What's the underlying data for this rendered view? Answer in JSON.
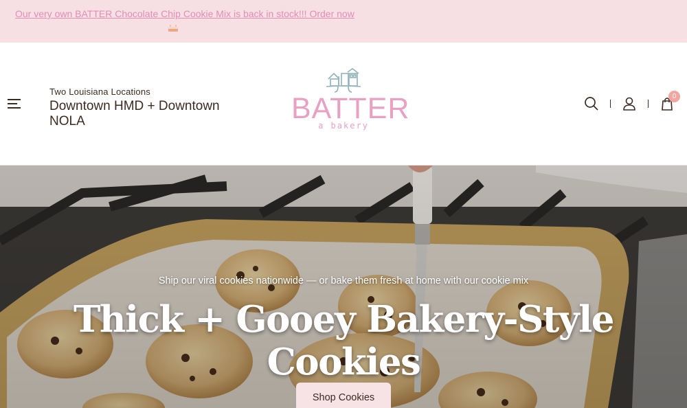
{
  "announcement": {
    "text": "Our very own BATTER Chocolate Chip Cookie Mix is back in stock!!! Order now"
  },
  "header": {
    "locations_label": "Two Louisiana Locations",
    "locations_line1": "Downtown HMD + Downtown",
    "locations_line2": "NOLA",
    "logo_text": "BATTER",
    "logo_tagline": "a bakery",
    "cart_count": "0"
  },
  "hero": {
    "subtitle": "Ship our viral cookies nationwide — or bake them fresh at home with our cookie mix",
    "headline": "Thick + Gooey Bakery-Style Cookies",
    "cta_label": "Shop Cookies"
  },
  "colors": {
    "announcement_bg": "#f6e0e3",
    "brand_pink": "#e8a0c3",
    "link_pink": "#e58bb6",
    "cart_badge": "#f2a6a0",
    "cta_bg": "#f7e3e6"
  },
  "icons": [
    "menu-icon",
    "search-icon",
    "account-icon",
    "cart-icon",
    "cake-emoji-icon",
    "house-logo-icon"
  ]
}
